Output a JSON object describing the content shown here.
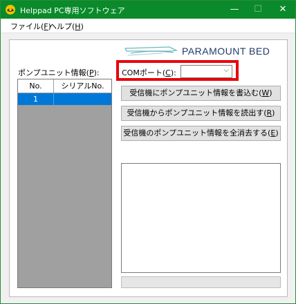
{
  "window": {
    "title": "Helppad PC専用ソフトウェア",
    "minimize_glyph": "—",
    "maximize_glyph": "☐",
    "close_glyph": "✕",
    "titlebar_color": "#0a8a2a"
  },
  "menu": {
    "file_main": "ファイル(",
    "file_key": "F",
    "file_end": ")",
    "help_main": "ヘルプ(",
    "help_key": "H",
    "help_end": ")"
  },
  "logo": {
    "text": "PARAMOUNT BED"
  },
  "pump_info": {
    "label_main": "ポンプユニット情報(",
    "label_key": "P",
    "label_end": "):",
    "columns": [
      "No.",
      "シリアルNo."
    ],
    "rows": [
      {
        "no": "1",
        "serial": ""
      }
    ],
    "selected_color": "#0078d7"
  },
  "com_port": {
    "label_main": "COMポート(",
    "label_key": "C",
    "label_end": "):",
    "value": "",
    "arrow_glyph": "⌵",
    "highlight_color": "#e8000a"
  },
  "buttons": {
    "write_main": "受信機にポンプユニット情報を書込む(",
    "write_key": "W",
    "write_end": ")",
    "read_main": "受信機からポンプユニット情報を読出す(",
    "read_key": "R",
    "read_end": ")",
    "erase_main": "受信機のポンプユニット情報を全消去する(",
    "erase_key": "E",
    "erase_end": ")"
  },
  "log": {
    "text": ""
  },
  "progress": {
    "value": 0
  }
}
